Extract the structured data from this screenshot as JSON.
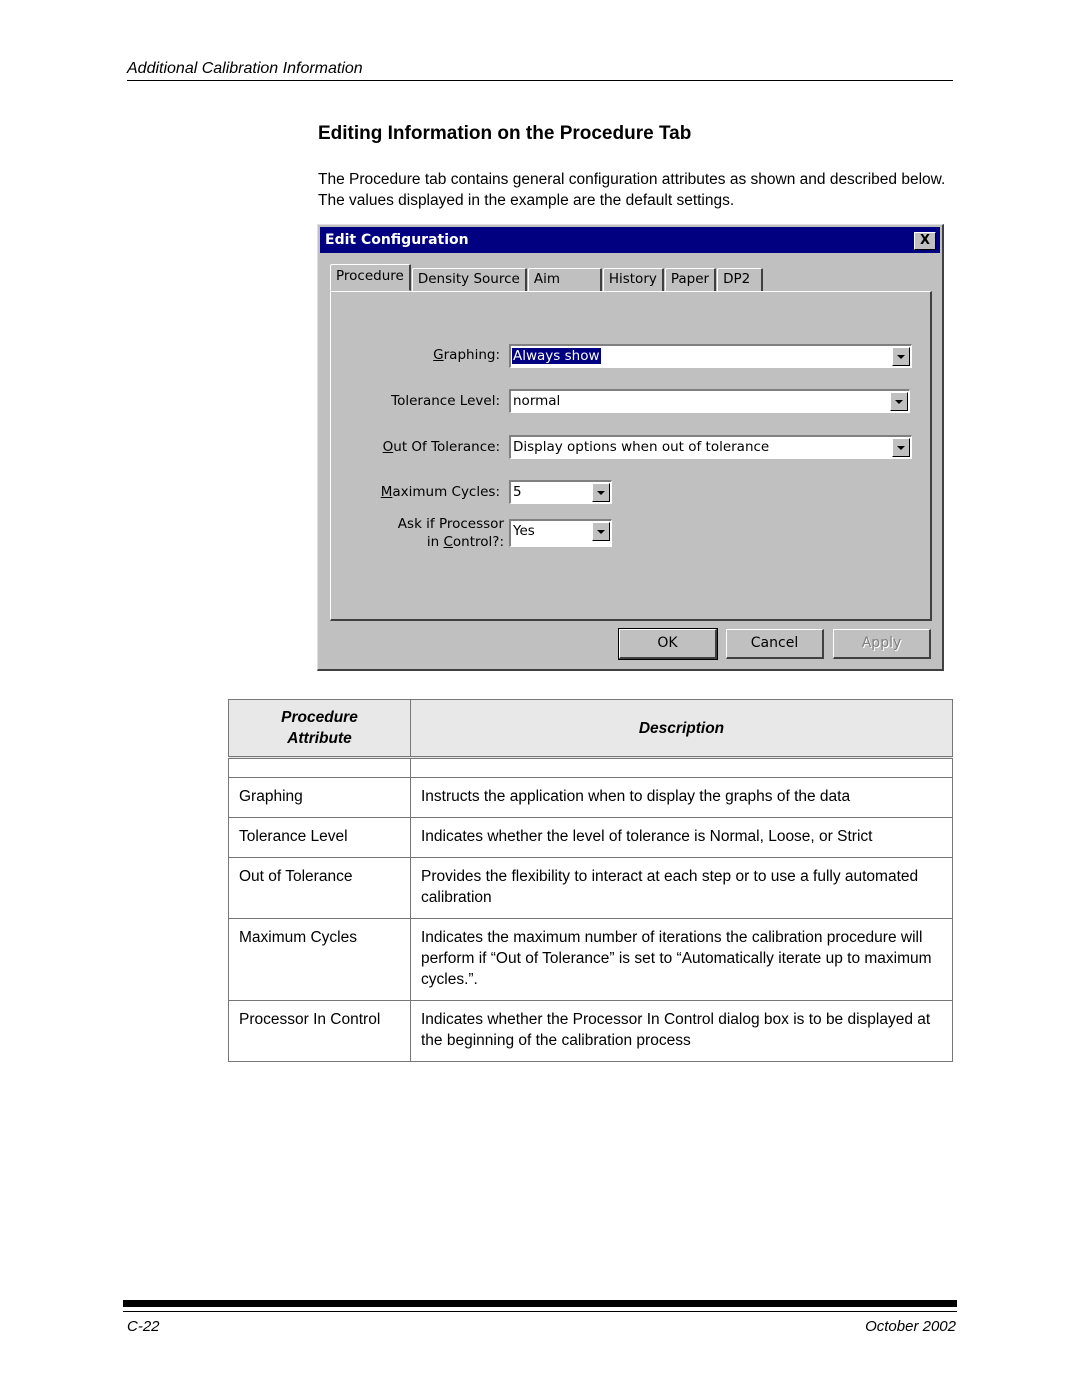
{
  "header": {
    "running_title": "Additional Calibration Information"
  },
  "section": {
    "title": "Editing Information on the Procedure Tab",
    "intro": "The Procedure tab contains general configuration attributes as shown and described below. The values displayed in the example are the default settings."
  },
  "dialog": {
    "title": "Edit Configuration",
    "close_label": "X",
    "tabs": [
      {
        "label": "Procedure",
        "active": true
      },
      {
        "label": "Density Source"
      },
      {
        "label": "Aim"
      },
      {
        "label": "History"
      },
      {
        "label": "Paper"
      },
      {
        "label": "DP2"
      }
    ],
    "fields": {
      "graphing": {
        "label_mn": "G",
        "label_rest": "raphing:",
        "value": "Always show"
      },
      "tolerance_level": {
        "label": "Tolerance Level:",
        "value": "normal"
      },
      "out_of_tolerance": {
        "label_mn": "O",
        "label_rest": "ut Of Tolerance:",
        "value": "Display options when out of tolerance"
      },
      "maximum_cycles": {
        "label_mn": "M",
        "label_rest": "aximum Cycles:",
        "value": "5"
      },
      "ask_processor": {
        "label_line1": "Ask if Processor",
        "label_pre": "in ",
        "label_mn": "C",
        "label_rest": "ontrol?:",
        "value": "Yes"
      }
    },
    "buttons": {
      "ok": "OK",
      "cancel": "Cancel",
      "apply": "Apply"
    }
  },
  "table": {
    "headers": {
      "attribute_line1": "Procedure",
      "attribute_line2": "Attribute",
      "description": "Description"
    },
    "rows": [
      {
        "attribute": "Graphing",
        "description": "Instructs the application when to display the graphs of the data"
      },
      {
        "attribute": "Tolerance Level",
        "description": "Indicates whether the level of tolerance is Normal, Loose, or Strict"
      },
      {
        "attribute": "Out of Tolerance",
        "description": "Provides the flexibility to interact at each step or to use a fully automated calibration"
      },
      {
        "attribute": "Maximum Cycles",
        "description": "Indicates the maximum number of iterations the calibration procedure will perform if “Out of Tolerance” is set to “Automatically iterate up to maximum cycles.”."
      },
      {
        "attribute": "Processor In Control",
        "description": "Indicates whether the Processor In Control dialog box is to be displayed at the beginning of the calibration process"
      }
    ]
  },
  "footer": {
    "page_number": "C-22",
    "date": "October 2002"
  }
}
